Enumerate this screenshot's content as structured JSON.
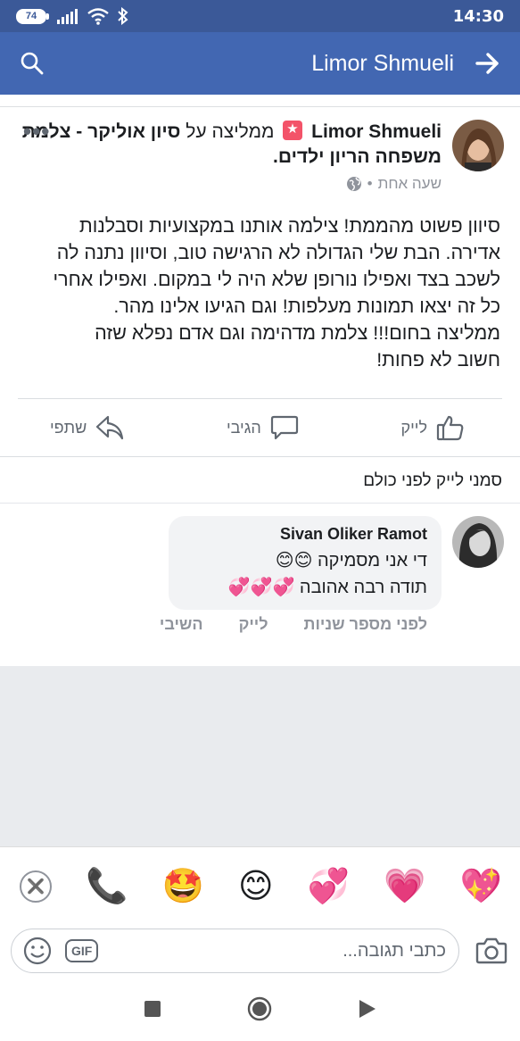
{
  "status_bar": {
    "battery": "74",
    "time": "14:30"
  },
  "nav": {
    "title": "Limor Shmueli"
  },
  "post": {
    "author": "Limor Shmueli",
    "recommends": "ממליצה על",
    "page_name": "סיון אוליקר - צלמת משפחה הריון ילדים.",
    "time": "שעה אחת",
    "separator": "•",
    "more": "•••",
    "body_lines": [
      "סיוון פשוט מהממת! צילמה אותנו במקצועיות וסבלנות",
      "אדירה. הבת שלי הגדולה לא הרגישה טוב, וסיוון נתנה לה",
      "לשכב בצד ואפילו נורופן שלא היה לי במקום. ואפילו אחרי",
      "כל זה יצאו תמונות מעלפות! וגם הגיעו אלינו מהר.",
      "ממליצה בחום!!! צלמת מדהימה וגם אדם נפלא שזה",
      "חשוב לא פחות!"
    ],
    "actions": {
      "like": "לייק",
      "comment": "הגיבי",
      "share": "שתפי"
    }
  },
  "first_like_prompt": "סמני לייק לפני כולם",
  "comment": {
    "author": "Sivan Oliker Ramot",
    "line1": "די אני מסמיקה 😊😊",
    "line2": "תודה רבה אהובה 💞💞💞",
    "time": "לפני מספר שניות",
    "like": "לייק",
    "reply": "השיבי"
  },
  "reactions": [
    "❌",
    "📞",
    "🤩",
    "😊",
    "💞",
    "💗",
    "💖"
  ],
  "composer": {
    "placeholder": "כתבי תגובה...",
    "gif": "GIF"
  },
  "colors": {
    "status_bar": "#3b5998",
    "nav_bar": "#4267b2",
    "gray_background": "#e9ebee",
    "badge": "#f35369"
  }
}
